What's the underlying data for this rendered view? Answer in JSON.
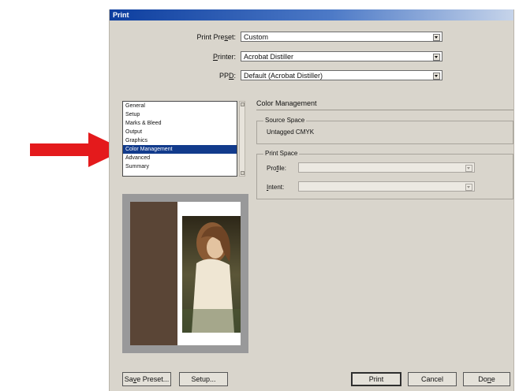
{
  "window": {
    "title": "Print"
  },
  "presets": {
    "print_preset_label_pre": "Print Pre",
    "print_preset_label_u": "s",
    "print_preset_label_post": "et:",
    "print_preset_value": "Custom",
    "printer_label_u": "P",
    "printer_label_post": "rinter:",
    "printer_value": "Acrobat Distiller",
    "ppd_label_pre": "PP",
    "ppd_label_u": "D",
    "ppd_label_post": ":",
    "ppd_value": "Default (Acrobat Distiller)"
  },
  "categories": [
    {
      "label": "General",
      "selected": false
    },
    {
      "label": "Setup",
      "selected": false
    },
    {
      "label": "Marks & Bleed",
      "selected": false
    },
    {
      "label": "Output",
      "selected": false
    },
    {
      "label": "Graphics",
      "selected": false
    },
    {
      "label": "Color Management",
      "selected": true
    },
    {
      "label": "Advanced",
      "selected": false
    },
    {
      "label": "Summary",
      "selected": false
    }
  ],
  "panel": {
    "title": "Color Management",
    "source_space_label": "Source Space",
    "source_space_value": "Untagged CMYK",
    "print_space_label": "Print Space",
    "profile_label_pre": "Pro",
    "profile_label_u": "f",
    "profile_label_post": "ile:",
    "intent_label_u": "I",
    "intent_label_post": "ntent:"
  },
  "buttons": {
    "save_preset_pre": "Sa",
    "save_preset_u": "v",
    "save_preset_post": "e Preset...",
    "setup": "Setup...",
    "print": "Print",
    "cancel": "Cancel",
    "done_pre": "Do",
    "done_u": "n",
    "done_post": "e"
  },
  "colors": {
    "titlebar": "#0d3e9f",
    "selection": "#123b8c",
    "arrow": "#e41a1c",
    "dialog_bg": "#d9d5cc"
  },
  "icons": {
    "callout": "red-arrow-icon",
    "dropdown": "dropdown-arrow-icon"
  }
}
